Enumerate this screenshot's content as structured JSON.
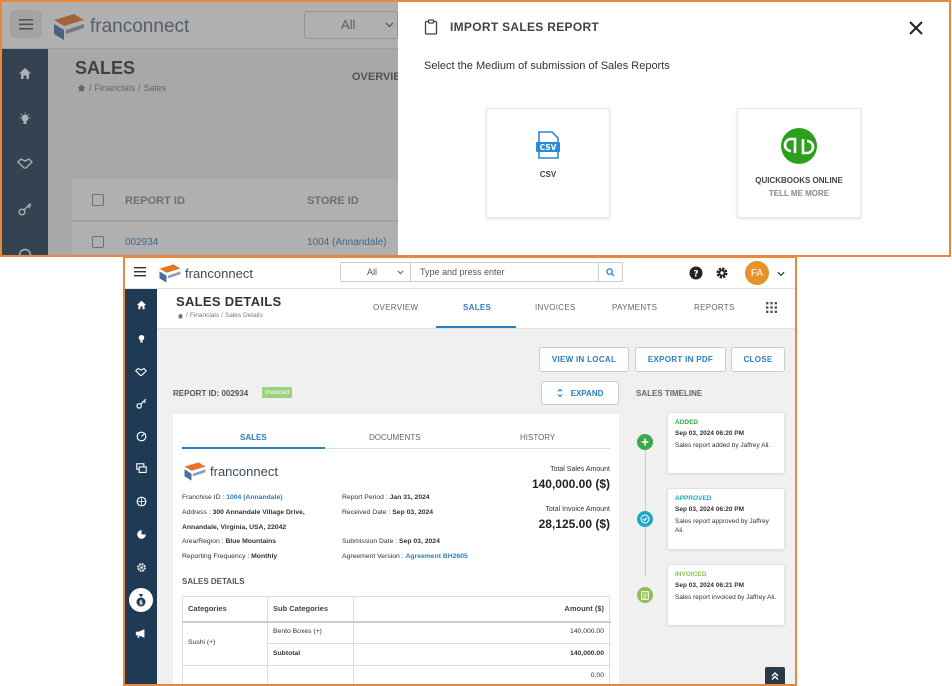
{
  "top": {
    "app_name": "franconnect",
    "filter_value": "All",
    "page_title": "SALES",
    "breadcrumb": [
      "Financials",
      "Sales"
    ],
    "overview_tab": "OVERVIE",
    "table": {
      "headers": [
        "REPORT ID",
        "STORE ID"
      ],
      "row": {
        "report_id": "002934",
        "store_id": "1004 (Annandale)"
      }
    },
    "modal": {
      "title": "IMPORT SALES REPORT",
      "subtitle": "Select the Medium of submission of Sales Reports",
      "options": [
        {
          "label": "CSV",
          "icon": "csv-file-icon"
        },
        {
          "label": "QUICKBOOKS ONLINE",
          "sublabel": "TELL ME MORE",
          "icon": "quickbooks-icon"
        }
      ]
    }
  },
  "bottom": {
    "app_name": "franconnect",
    "search": {
      "scope": "All",
      "placeholder": "Type and press enter"
    },
    "user_initials": "FA",
    "page_title": "SALES DETAILS",
    "breadcrumb": [
      "Financials",
      "Sales Details"
    ],
    "tabs": [
      "OVERVIEW",
      "SALES",
      "INVOICES",
      "PAYMENTS",
      "REPORTS"
    ],
    "active_tab": "SALES",
    "actions": {
      "view_local": "VIEW IN LOCAL",
      "export_pdf": "EXPORT IN PDF",
      "close": "CLOSE"
    },
    "report_id": "REPORT ID: 002934",
    "status_badge": "Invoiced",
    "expand_label": "EXPAND",
    "timeline_title": "SALES TIMELINE",
    "card": {
      "tabs": [
        "SALES",
        "DOCUMENTS",
        "HISTORY"
      ],
      "logo_text": "franconnect",
      "franchise_id_label": "Franchise ID : ",
      "franchise_id": "1004 (Annandale)",
      "address_label": "Address : ",
      "address_line1": "300 Annandale Village Drive,",
      "address_line2": "Annandale, Virginia, USA, 22042",
      "area_label": "Area/Region : ",
      "area": "Blue Mountains",
      "freq_label": "Reporting Frequency : ",
      "freq": "Monthly",
      "period_label": "Report Period : ",
      "period": "Jan 31, 2024",
      "received_label": "Received Date : ",
      "received": "Sep 03, 2024",
      "submission_label": "Submission Date : ",
      "submission": "Sep 03, 2024",
      "agreement_label": "Agreement Version : ",
      "agreement": "Agreement BH2605",
      "total_sales_label": "Total Sales Amount",
      "total_sales": "140,000.00 ($)",
      "total_invoice_label": "Total Invoice Amount",
      "total_invoice": "28,125.00 ($)",
      "sales_details_heading": "SALES DETAILS",
      "table": {
        "headers": [
          "Categories",
          "Sub Categories",
          "Amount ($)"
        ],
        "rows": [
          {
            "category": "Sushi (+)",
            "sub": "Bento Boxes (+)",
            "amount": "140,000.00"
          },
          {
            "category": "",
            "sub": "Subtotal",
            "amount": "140,000.00"
          },
          {
            "category": "",
            "sub": "",
            "amount": "0.00"
          }
        ]
      }
    },
    "timeline": [
      {
        "status": "ADDED",
        "date": "Sep 03, 2024 06:20 PM",
        "text": "Sales report added by Jaffrey Ali.",
        "color": "#3aa94a"
      },
      {
        "status": "APPROVED",
        "date": "Sep 03, 2024 06:20 PM",
        "text": "Sales report approved by Jaffrey Ali.",
        "color": "#1ea7c4"
      },
      {
        "status": "INVOICED",
        "date": "Sep 03, 2024 06:21 PM",
        "text": "Sales report invoiced by Jaffrey Ali.",
        "color": "#8cc152"
      }
    ],
    "colors": {
      "accent": "#2a7fbf",
      "sidebar": "#1e3a55",
      "frame": "#e8883a"
    }
  }
}
